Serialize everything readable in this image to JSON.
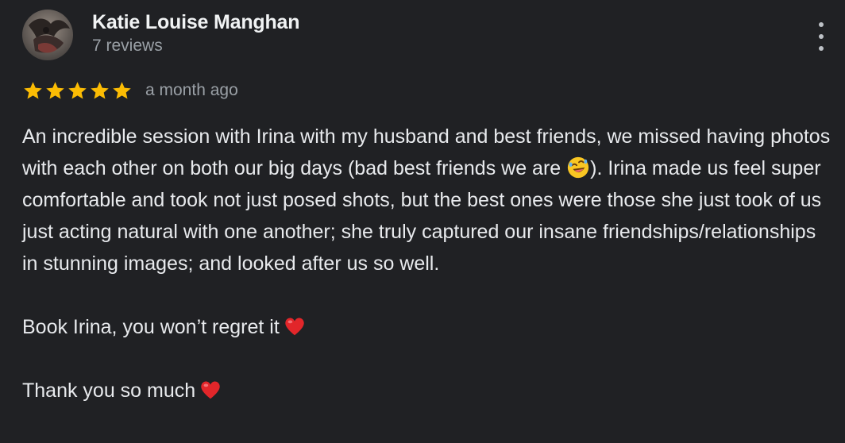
{
  "reviewer": {
    "name": "Katie Louise Manghan",
    "review_count": "7 reviews"
  },
  "review": {
    "rating": 5,
    "rating_max": 5,
    "time_ago": "a month ago",
    "paragraph1_a": "An incredible session with Irina with my husband and best friends, we missed having photos with each other on both our big days (bad best friends we are ",
    "paragraph1_b": "). Irina made us feel super comfortable and took not just posed shots, but the best ones were those she just took of us just acting natural with one another; she truly captured our insane friendships/relationships in stunning images; and looked after us so well.",
    "paragraph2": "Book Irina, you won’t regret it",
    "paragraph3": "Thank you so much"
  },
  "colors": {
    "background": "#202124",
    "star": "#fbbc04",
    "heart": "#e2262a",
    "secondary_text": "#9aa0a6"
  },
  "icons": {
    "menu": "more-vert-icon",
    "emoji_laugh": "rolling-on-floor-laughing-emoji",
    "emoji_heart": "red-heart-emoji"
  }
}
